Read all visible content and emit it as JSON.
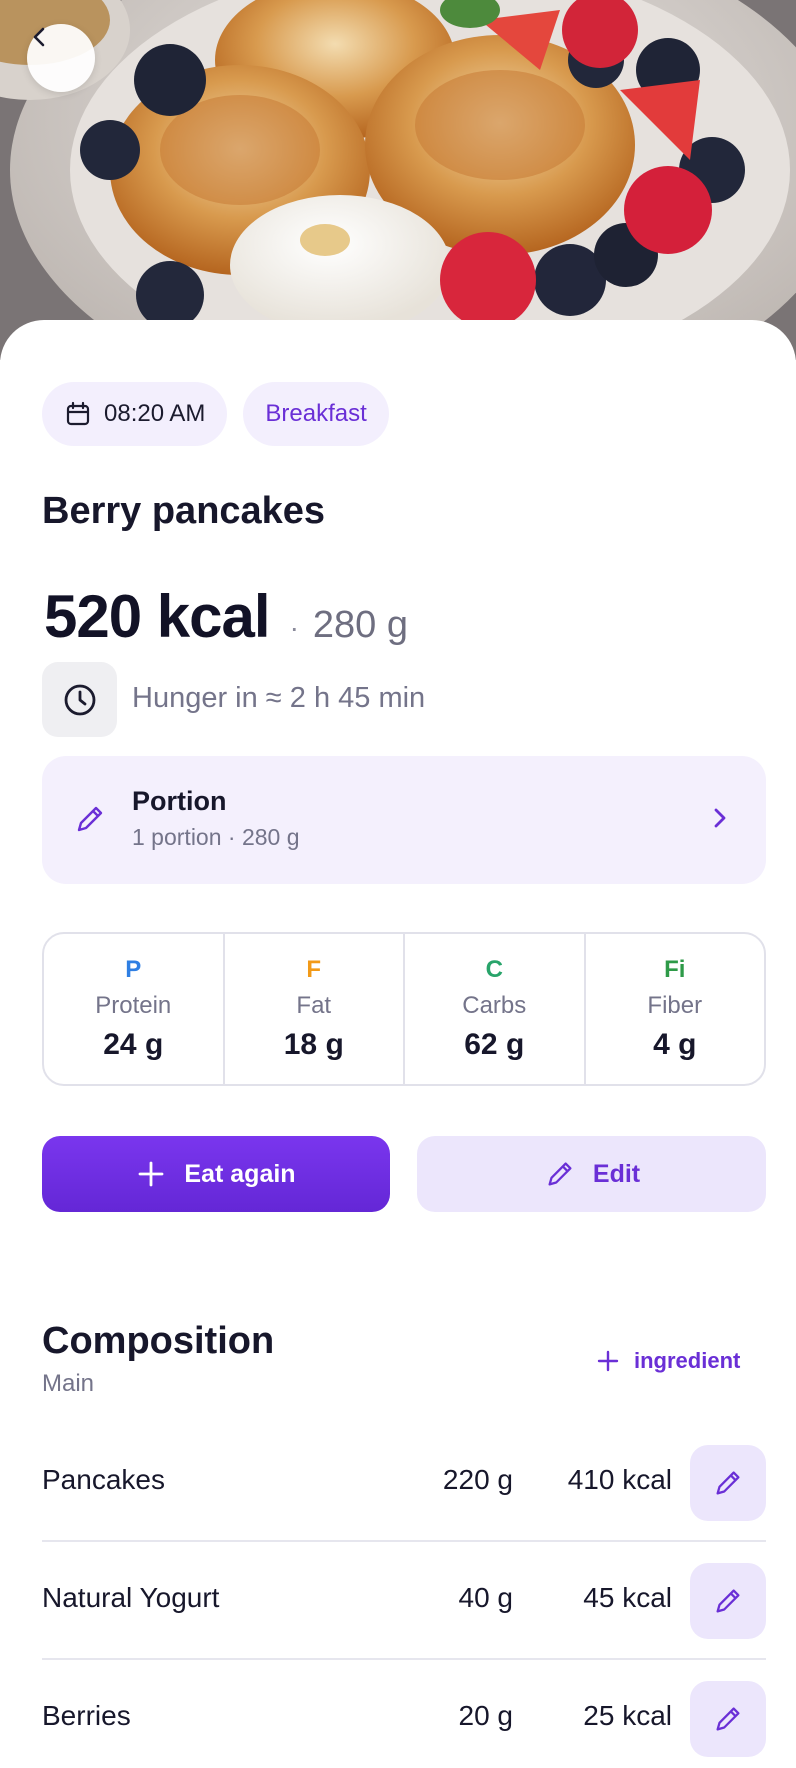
{
  "header": {
    "back_icon": "chevron-left-icon",
    "image_subject": "photo"
  },
  "meta": {
    "time": "08:20 AM",
    "meal": "Breakfast"
  },
  "meal": {
    "title": "Berry pancakes",
    "kcal": "520 kcal",
    "separator": "·",
    "weight": "280 g",
    "hunger": "Hunger in ≈ 2 h 45 min"
  },
  "portion": {
    "title": "Portion",
    "subtitle": "1 portion · 280 g"
  },
  "macros": [
    {
      "letter": "P",
      "name": "Protein",
      "value": "24 g",
      "color": "#2f7fe3"
    },
    {
      "letter": "F",
      "name": "Fat",
      "value": "18 g",
      "color": "#f29a18"
    },
    {
      "letter": "C",
      "name": "Carbs",
      "value": "62 g",
      "color": "#28a46a"
    },
    {
      "letter": "Fi",
      "name": "Fiber",
      "value": "4 g",
      "color": "#2e9a48"
    }
  ],
  "actions": {
    "eat_again": "Eat again",
    "edit": "Edit"
  },
  "composition": {
    "title": "Composition",
    "subtitle": "Main",
    "add_label": "ingredient",
    "items": [
      {
        "name": "Pancakes",
        "weight": "220 g",
        "kcal": "410 kcal"
      },
      {
        "name": "Natural Yogurt",
        "weight": "40 g",
        "kcal": "45 kcal"
      },
      {
        "name": "Berries",
        "weight": "20 g",
        "kcal": "25 kcal"
      }
    ]
  },
  "colors": {
    "accent": "#6a2fd6",
    "accent_light": "#ece6fc"
  }
}
